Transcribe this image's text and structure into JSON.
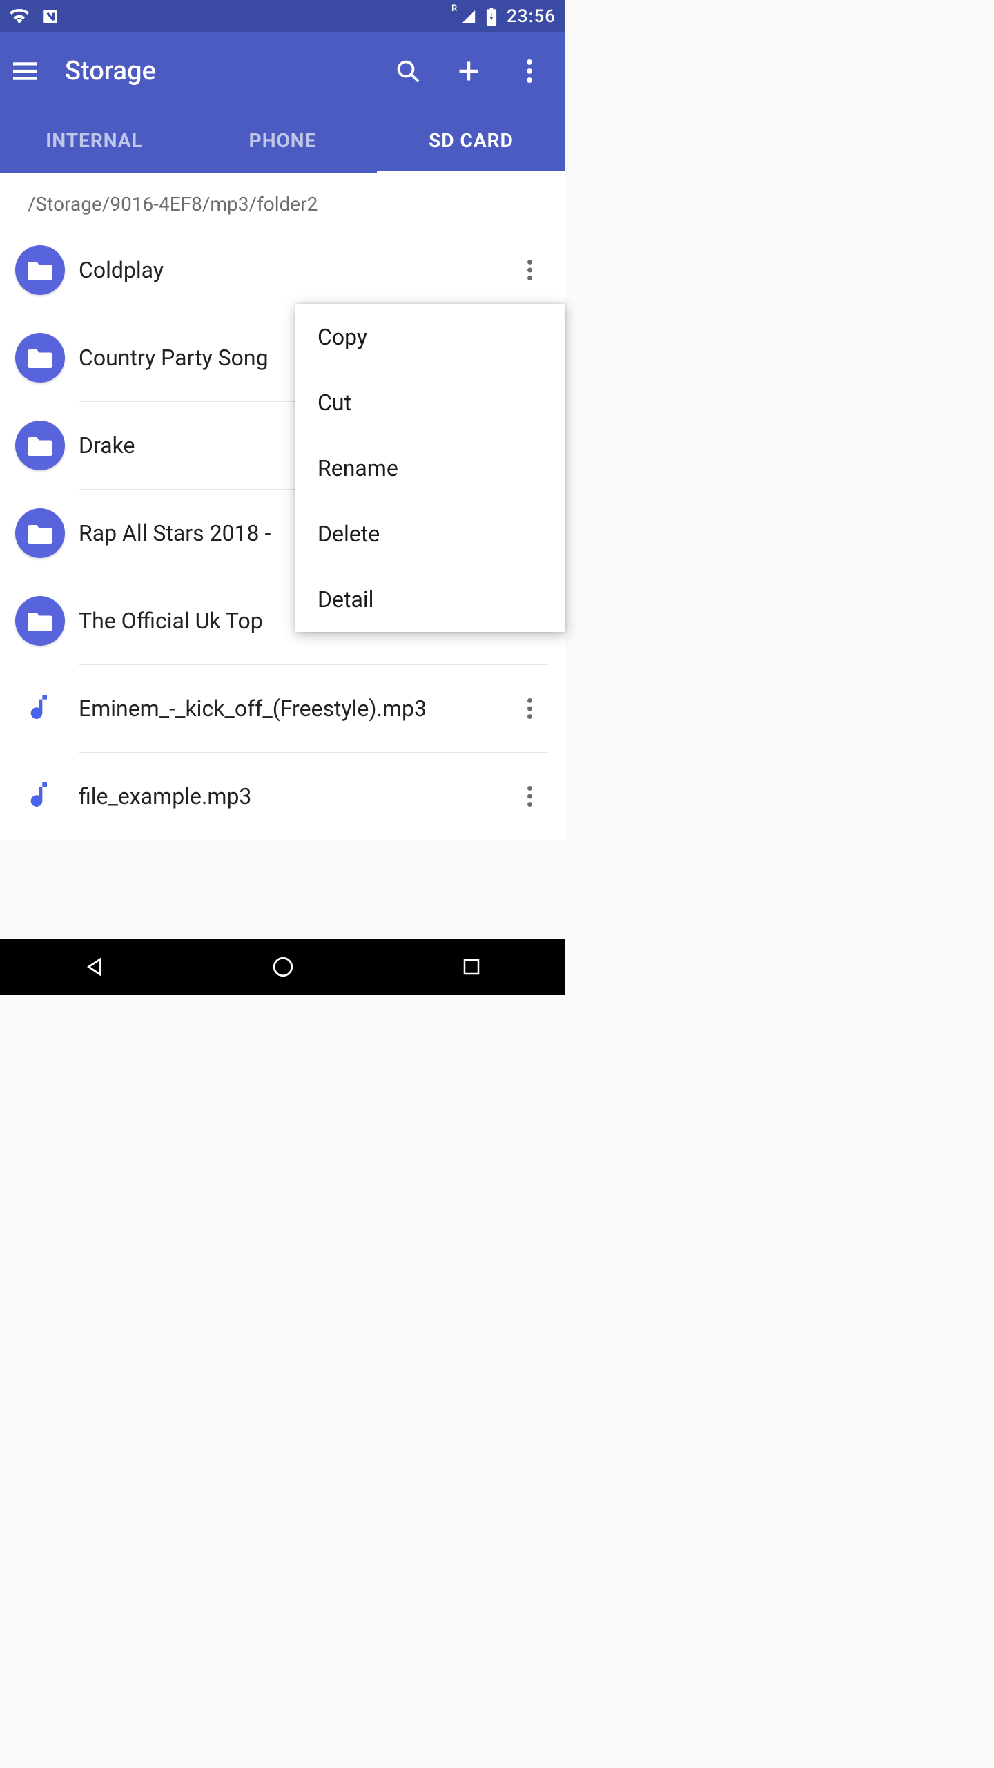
{
  "status": {
    "clock": "23:56",
    "battery_icon": "battery-charging",
    "signal_label": "R"
  },
  "appbar": {
    "title": "Storage"
  },
  "tabs": {
    "items": [
      {
        "label": "INTERNAL",
        "active": false
      },
      {
        "label": "PHONE",
        "active": false
      },
      {
        "label": "SD CARD",
        "active": true
      }
    ]
  },
  "path": "/Storage/9016-4EF8/mp3/folder2",
  "entries": [
    {
      "type": "folder",
      "name": "Coldplay"
    },
    {
      "type": "folder",
      "name": "Country Party Song"
    },
    {
      "type": "folder",
      "name": "Drake"
    },
    {
      "type": "folder",
      "name": "Rap All Stars 2018 -"
    },
    {
      "type": "folder",
      "name": "The Official Uk Top"
    },
    {
      "type": "music",
      "name": "Eminem_-_kick_off_(Freestyle).mp3"
    },
    {
      "type": "music",
      "name": "file_example.mp3"
    }
  ],
  "context_menu": {
    "items": [
      {
        "label": "Copy"
      },
      {
        "label": "Cut"
      },
      {
        "label": "Rename"
      },
      {
        "label": "Delete"
      },
      {
        "label": "Detail"
      }
    ]
  },
  "colors": {
    "primary": "#4c5bc2",
    "primary_dark": "#3b4aa3",
    "accent": "#5764db"
  }
}
